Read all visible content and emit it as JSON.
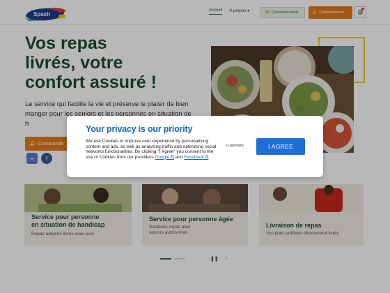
{
  "header": {
    "logo_text": "Spash",
    "nav": [
      {
        "label": "Accueil",
        "active": true
      },
      {
        "label": "À propos ▾",
        "active": false
      }
    ],
    "contact_label": "Contactez-nous",
    "order_label": "Commandez ▾"
  },
  "hero": {
    "title_line1": "Vos repas",
    "title_line2": "livrés, votre",
    "title_line3": "confort assuré !",
    "text_visible": "Le service qui facilite la vie et préserve le plaisir de bien manger pour les seniors et les personnes en situation de h",
    "button_label": "Commande"
  },
  "cards": [
    {
      "title_line1": "Service pour personne",
      "title_line2": "en situation de handicap",
      "subtitle": "Repas adaptés livrés avec soin"
    },
    {
      "title_line1": "Service pour personne âgée",
      "subtitle_line1": "Solutions repas pour",
      "subtitle_line2": "seniors autonomes"
    },
    {
      "title_line1": "Livraison de repas",
      "subtitle": "Vos plats préférés directement livrés"
    }
  ],
  "cookie_modal": {
    "title": "Your privacy is our priority",
    "body": "We use Cookies to improve user experience by personalising content and ads, as well as analyzing traffic and optimizing social networks functionalities. By clicking \"I Agree\" you consent to the use of Cookies from our providers",
    "link_google": "Google",
    "link_and": "and",
    "link_facebook": "Facebook",
    "customize_label": "Customize",
    "agree_label": "I AGREE"
  },
  "colors": {
    "brand_green": "#1e4d31",
    "accent_orange": "#e47a1c",
    "modal_blue": "#1565c0",
    "agree_blue": "#1e6ed4"
  }
}
